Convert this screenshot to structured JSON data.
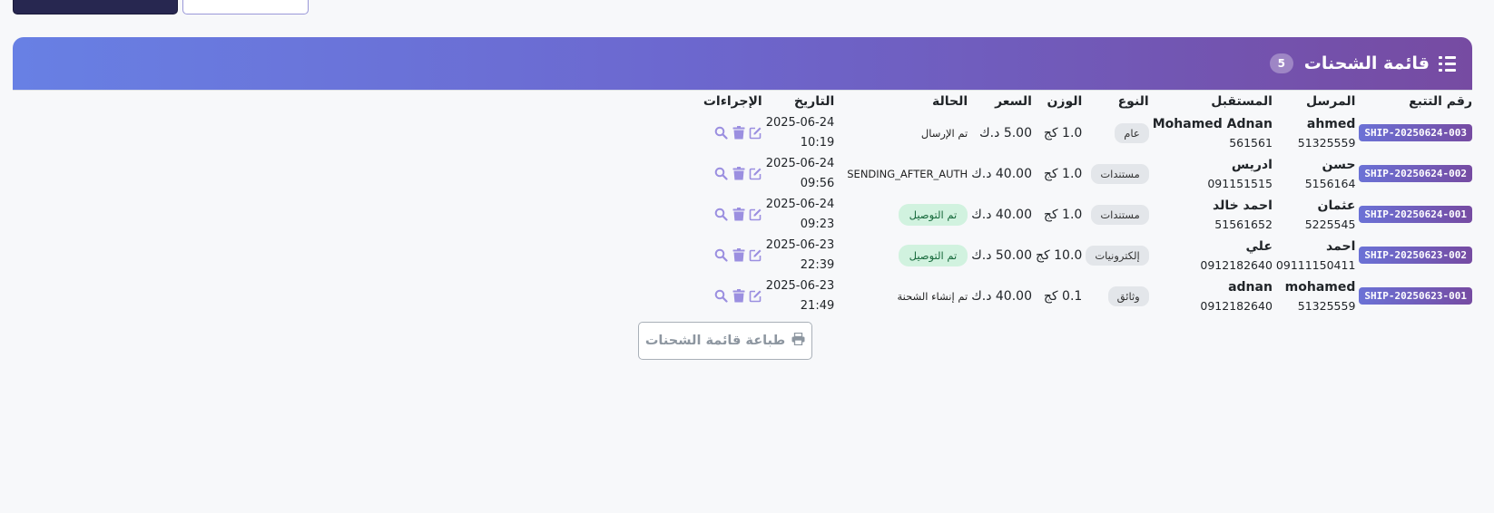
{
  "header": {
    "title": "قائمة الشحنات",
    "count": "5"
  },
  "table": {
    "columns": [
      "رقم التتبع",
      "المرسل",
      "المستقبل",
      "النوع",
      "الوزن",
      "السعر",
      "الحالة",
      "التاريخ",
      "الإجراءات"
    ],
    "rows": [
      {
        "tracking": "SHIP-20250624-003",
        "sender_name": "ahmed",
        "sender_phone": "51325559",
        "receiver_name": "Mohamed Adnan",
        "receiver_phone": "561561",
        "type": "عام",
        "weight": "1.0 كج",
        "price": "5.00 د.ك",
        "status": "تم الإرسال",
        "status_style": "plain",
        "date": "2025-06-24",
        "time": "10:19"
      },
      {
        "tracking": "SHIP-20250624-002",
        "sender_name": "حسن",
        "sender_phone": "5156164",
        "receiver_name": "ادريس",
        "receiver_phone": "091151515",
        "type": "مستندات",
        "weight": "1.0 كج",
        "price": "40.00 د.ك",
        "status": "SENDING_AFTER_AUTH",
        "status_style": "plain",
        "date": "2025-06-24",
        "time": "09:56"
      },
      {
        "tracking": "SHIP-20250624-001",
        "sender_name": "عثمان",
        "sender_phone": "5225545",
        "receiver_name": "احمد خالد",
        "receiver_phone": "51561652",
        "type": "مستندات",
        "weight": "1.0 كج",
        "price": "40.00 د.ك",
        "status": "تم التوصيل",
        "status_style": "green",
        "date": "2025-06-24",
        "time": "09:23"
      },
      {
        "tracking": "SHIP-20250623-002",
        "sender_name": "احمد",
        "sender_phone": "09111150411",
        "receiver_name": "علي",
        "receiver_phone": "0912182640",
        "type": "إلكترونيات",
        "weight": "10.0 كج",
        "price": "50.00 د.ك",
        "status": "تم التوصيل",
        "status_style": "green",
        "date": "2025-06-23",
        "time": "22:39"
      },
      {
        "tracking": "SHIP-20250623-001",
        "sender_name": "mohamed",
        "sender_phone": "51325559",
        "receiver_name": "adnan",
        "receiver_phone": "0912182640",
        "type": "وثائق",
        "weight": "0.1 كج",
        "price": "40.00 د.ك",
        "status": "تم إنشاء الشحنة",
        "status_style": "plain",
        "date": "2025-06-23",
        "time": "21:49"
      }
    ]
  },
  "print_button": {
    "label": "طباعة قائمة الشحنات"
  },
  "colors": {
    "header_gradient_start": "#6880e4",
    "header_gradient_end": "#764ba2",
    "action_icon": "#9b8fe0",
    "delivered_bg": "#d1f2df"
  },
  "icons": {
    "header": "list-icon",
    "row_actions": [
      "edit-icon",
      "trash-icon",
      "search-icon"
    ],
    "print": "printer-icon"
  }
}
